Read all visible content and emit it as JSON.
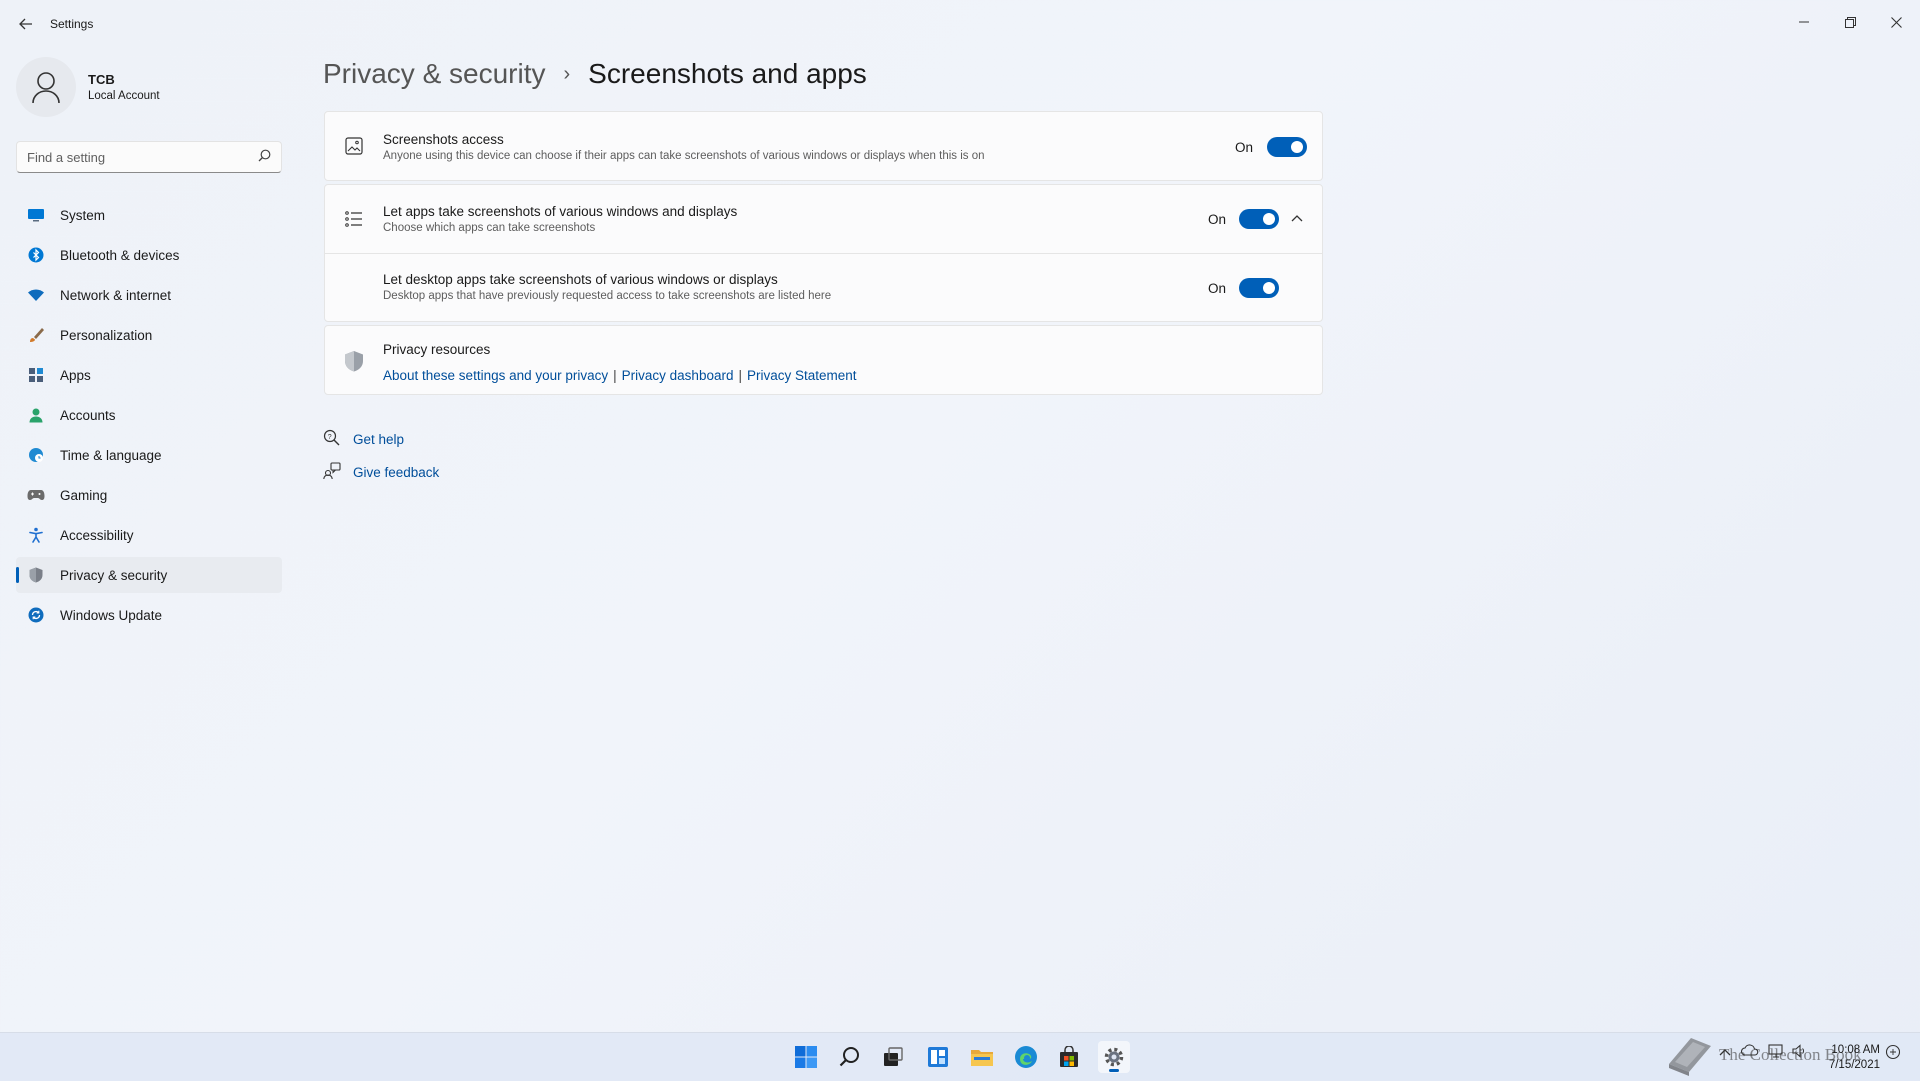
{
  "window": {
    "title": "Settings"
  },
  "user": {
    "name": "TCB",
    "account_type": "Local Account"
  },
  "search": {
    "placeholder": "Find a setting"
  },
  "nav": [
    {
      "label": "System",
      "icon": "monitor-icon",
      "color": "#0078d4"
    },
    {
      "label": "Bluetooth & devices",
      "icon": "bluetooth-icon",
      "color": "#0078d4"
    },
    {
      "label": "Network & internet",
      "icon": "wifi-icon",
      "color": "#0f6cbd"
    },
    {
      "label": "Personalization",
      "icon": "brush-icon",
      "color": "#d17a2a"
    },
    {
      "label": "Apps",
      "icon": "apps-icon",
      "color": "#4a5e7a"
    },
    {
      "label": "Accounts",
      "icon": "person-icon",
      "color": "#2aa36b"
    },
    {
      "label": "Time & language",
      "icon": "globe-clock-icon",
      "color": "#1f8ad2"
    },
    {
      "label": "Gaming",
      "icon": "gamepad-icon",
      "color": "#666666"
    },
    {
      "label": "Accessibility",
      "icon": "accessibility-icon",
      "color": "#1f6fd0"
    },
    {
      "label": "Privacy & security",
      "icon": "shield-icon",
      "color": "#7a7f88",
      "active": true
    },
    {
      "label": "Windows Update",
      "icon": "update-icon",
      "color": "#0f6cbd"
    }
  ],
  "header": {
    "parent": "Privacy & security",
    "separator": "›",
    "current": "Screenshots and apps"
  },
  "settings": {
    "screenshots_access": {
      "title": "Screenshots access",
      "description": "Anyone using this device can choose if their apps can take screenshots of various windows or displays when this is on",
      "state": "On"
    },
    "let_apps": {
      "title": "Let apps take screenshots of various windows and displays",
      "description": "Choose which apps can take screenshots",
      "state": "On",
      "expanded": true
    },
    "let_desktop_apps": {
      "title": "Let desktop apps take screenshots of various windows or displays",
      "description": "Desktop apps that have previously requested access to take screenshots are listed here",
      "state": "On"
    }
  },
  "privacy_resources": {
    "title": "Privacy resources",
    "links": [
      "About these settings and your privacy",
      "Privacy dashboard",
      "Privacy Statement"
    ],
    "separator": "|"
  },
  "help": {
    "get_help": "Get help",
    "give_feedback": "Give feedback"
  },
  "taskbar": {
    "icons": [
      "start-icon",
      "search-icon",
      "task-view-icon",
      "widgets-icon",
      "file-explorer-icon",
      "edge-icon",
      "store-icon",
      "settings-icon"
    ],
    "clock_time": "10:08 AM",
    "clock_date": "7/15/2021"
  },
  "watermark": {
    "text": "The Collection Book"
  },
  "colors": {
    "accent": "#005fb8",
    "link": "#004e9a"
  }
}
